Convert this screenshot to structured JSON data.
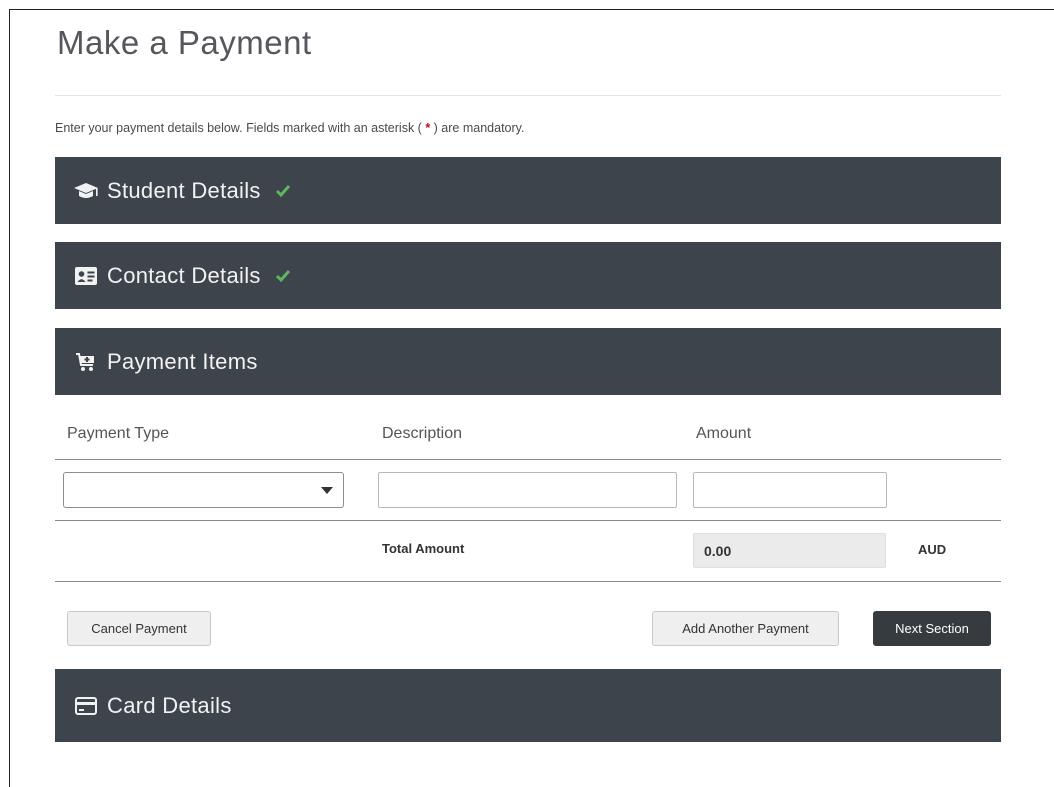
{
  "page": {
    "title": "Make a Payment",
    "intro_before": "Enter your payment details below. Fields marked with an asterisk (",
    "intro_asterisk": "*",
    "intro_after": ") are mandatory."
  },
  "sections": {
    "student": {
      "label": "Student Details",
      "icon": "graduation-cap-icon",
      "complete": true
    },
    "contact": {
      "label": "Contact Details",
      "icon": "contact-card-icon",
      "complete": true
    },
    "items": {
      "label": "Payment Items",
      "icon": "cart-add-icon"
    },
    "card": {
      "label": "Card Details",
      "icon": "credit-card-icon"
    }
  },
  "payment_items": {
    "columns": {
      "type": "Payment Type",
      "description": "Description",
      "amount": "Amount"
    },
    "row": {
      "payment_type": "",
      "description": "",
      "amount": ""
    },
    "total_label": "Total Amount",
    "total_value": "0.00",
    "currency": "AUD"
  },
  "buttons": {
    "cancel": "Cancel Payment",
    "add_another": "Add Another Payment",
    "next": "Next Section"
  },
  "colors": {
    "section_bar": "#3e444b",
    "check": "#5cb85c",
    "asterisk": "#d0021b",
    "primary_button": "#363b40"
  }
}
